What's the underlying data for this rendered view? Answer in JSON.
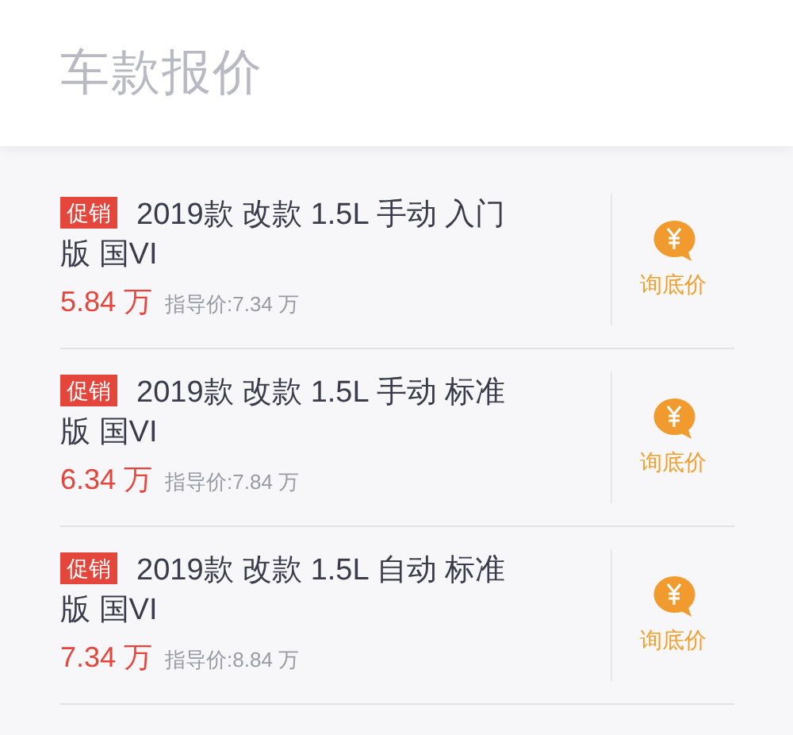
{
  "header": {
    "title": "车款报价"
  },
  "cars": [
    {
      "badge": "促销",
      "name": "2019款 改款 1.5L 手动 入门版 国VI",
      "price": "5.84 万",
      "guide_price": "指导价:7.34 万",
      "action": "询底价"
    },
    {
      "badge": "促销",
      "name": "2019款 改款 1.5L 手动 标准版 国VI",
      "price": "6.34 万",
      "guide_price": "指导价:7.84 万",
      "action": "询底价"
    },
    {
      "badge": "促销",
      "name": "2019款 改款 1.5L 自动 标准版 国VI",
      "price": "7.34 万",
      "guide_price": "指导价:8.84 万",
      "action": "询底价"
    }
  ]
}
